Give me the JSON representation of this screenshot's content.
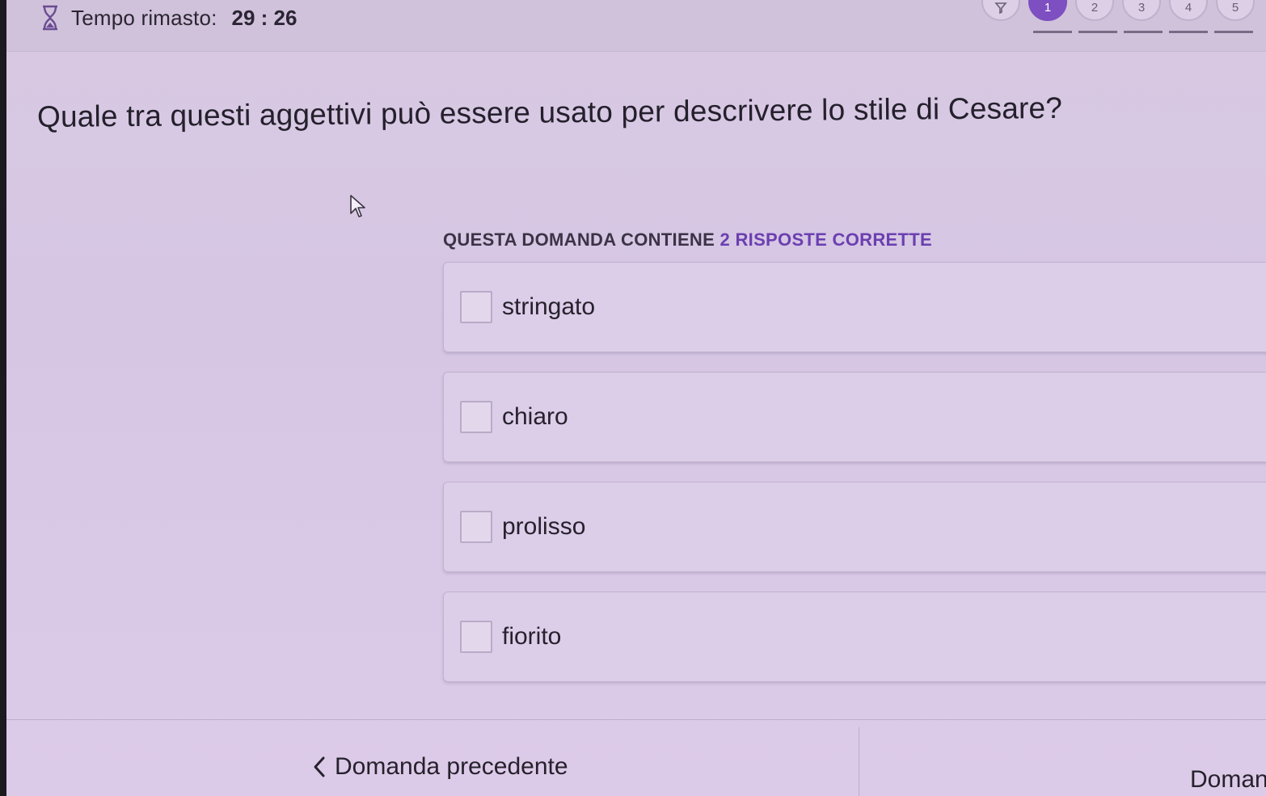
{
  "timer": {
    "label": "Tempo rimasto:",
    "value": "29 : 26",
    "icon": "hourglass-icon"
  },
  "steps": {
    "items": [
      "1",
      "2",
      "3",
      "4",
      "5"
    ],
    "current": "1"
  },
  "question": {
    "text": "Quale tra questi aggettivi può essere usato per descrivere lo stile di Cesare?"
  },
  "hint": {
    "prefix": "QUESTA DOMANDA CONTIENE",
    "count": "2",
    "suffix": "RISPOSTE CORRETTE"
  },
  "answers": [
    {
      "label": "stringato",
      "checked": false
    },
    {
      "label": "chiaro",
      "checked": false
    },
    {
      "label": "prolisso",
      "checked": false
    },
    {
      "label": "fiorito",
      "checked": false
    }
  ],
  "nav": {
    "prev_label": "Domanda precedente",
    "next_label": "Domanda successiva"
  },
  "colors": {
    "accent": "#7d4fc1",
    "background": "#d6c6e4",
    "text": "#26212d"
  }
}
